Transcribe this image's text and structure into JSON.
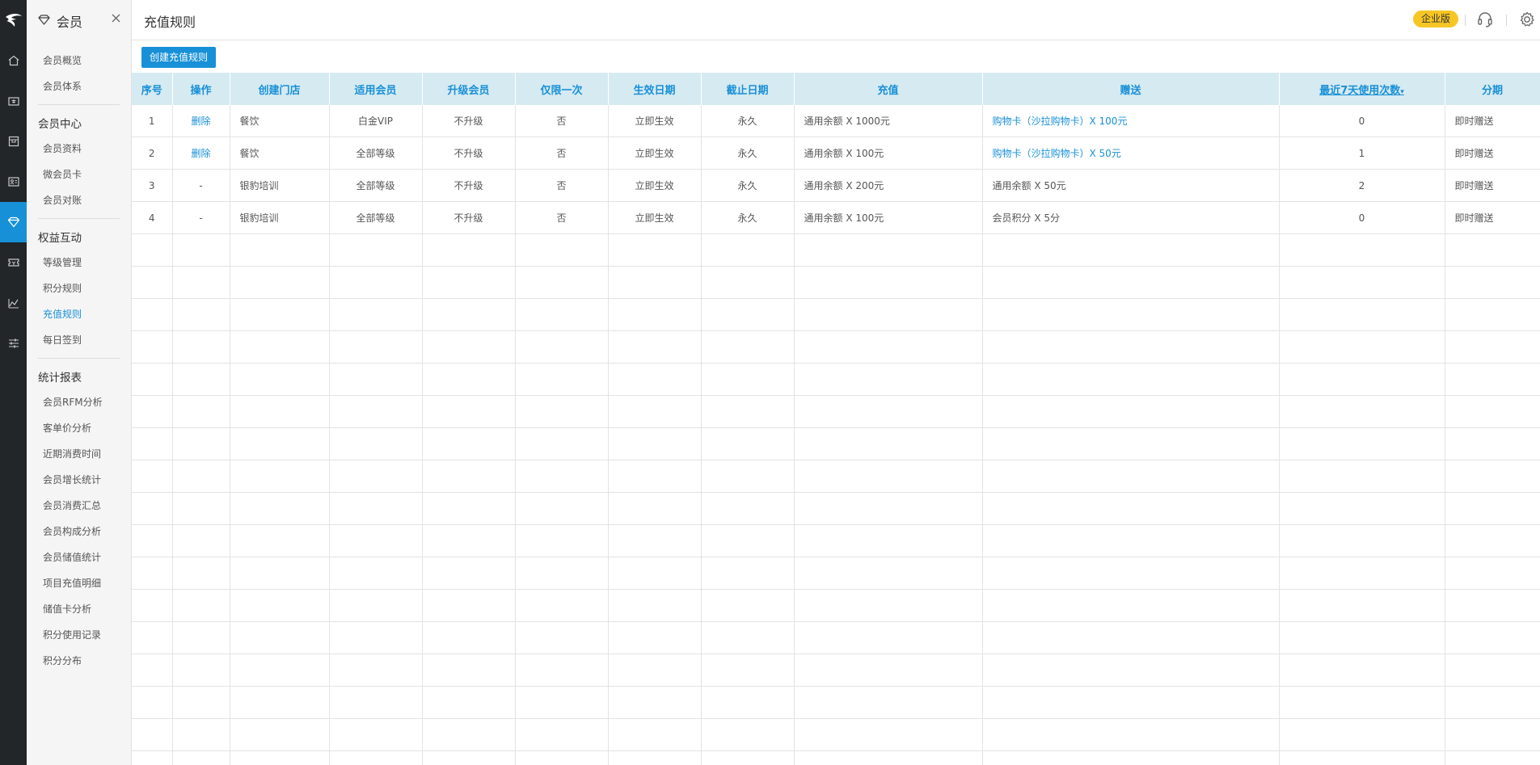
{
  "rail": {
    "items": [
      {
        "name": "home-icon"
      },
      {
        "name": "cashier-icon"
      },
      {
        "name": "goods-icon"
      },
      {
        "name": "member-card-icon"
      },
      {
        "name": "diamond-icon",
        "active": true
      },
      {
        "name": "coupon-icon"
      },
      {
        "name": "chart-icon"
      },
      {
        "name": "settings-sliders-icon"
      }
    ]
  },
  "sidebar": {
    "title": "会员",
    "items_top": [
      "会员概览",
      "会员体系"
    ],
    "group1": {
      "title": "会员中心",
      "items": [
        "会员资料",
        "微会员卡",
        "会员对账"
      ]
    },
    "group2": {
      "title": "权益互动",
      "items": [
        "等级管理",
        "积分规则",
        "充值规则",
        "每日签到"
      ]
    },
    "group3": {
      "title": "统计报表",
      "items": [
        "会员RFM分析",
        "客单价分析",
        "近期消费时间",
        "会员增长统计",
        "会员消费汇总",
        "会员构成分析",
        "会员储值统计",
        "项目充值明细",
        "储值卡分析",
        "积分使用记录",
        "积分分布"
      ]
    }
  },
  "header": {
    "title": "充值规则",
    "edition_badge": "企业版"
  },
  "toolbar": {
    "create_label": "创建充值规则"
  },
  "table": {
    "columns": [
      "序号",
      "操作",
      "创建门店",
      "适用会员",
      "升级会员",
      "仅限一次",
      "生效日期",
      "截止日期",
      "充值",
      "赠送",
      "最近7天使用次数",
      "分期"
    ],
    "sort_indicator": "▾",
    "rows": [
      {
        "no": "1",
        "op": "删除",
        "store": "餐饮",
        "member": "白金VIP",
        "upgrade": "不升级",
        "once": "否",
        "start": "立即生效",
        "end": "永久",
        "recharge": "通用余额 X 1000元",
        "gift": "购物卡（沙拉购物卡）X 100元",
        "gift_link": true,
        "uses": "0",
        "installment": "即时赠送"
      },
      {
        "no": "2",
        "op": "删除",
        "store": "餐饮",
        "member": "全部等级",
        "upgrade": "不升级",
        "once": "否",
        "start": "立即生效",
        "end": "永久",
        "recharge": "通用余额 X 100元",
        "gift": "购物卡（沙拉购物卡）X 50元",
        "gift_link": true,
        "uses": "1",
        "installment": "即时赠送"
      },
      {
        "no": "3",
        "op": "-",
        "store": "银豹培训",
        "member": "全部等级",
        "upgrade": "不升级",
        "once": "否",
        "start": "立即生效",
        "end": "永久",
        "recharge": "通用余额 X 200元",
        "gift": "通用余额 X 50元",
        "gift_link": false,
        "uses": "2",
        "installment": "即时赠送"
      },
      {
        "no": "4",
        "op": "-",
        "store": "银豹培训",
        "member": "全部等级",
        "upgrade": "不升级",
        "once": "否",
        "start": "立即生效",
        "end": "永久",
        "recharge": "通用余额 X 100元",
        "gift": "会员积分 X 5分",
        "gift_link": false,
        "uses": "0",
        "installment": "即时赠送"
      }
    ]
  }
}
